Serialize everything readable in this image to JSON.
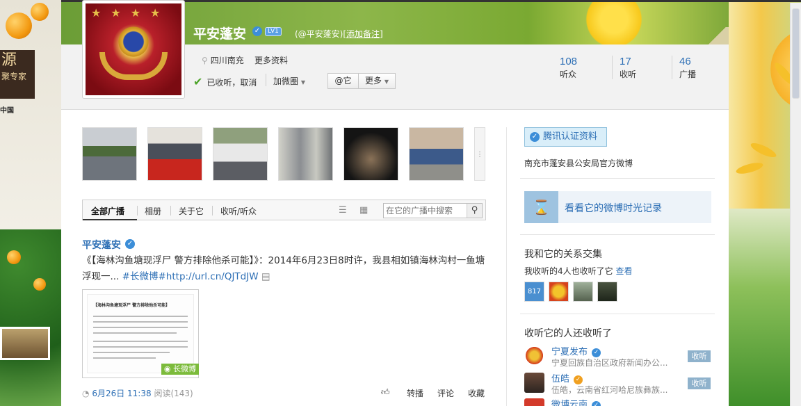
{
  "profile": {
    "name": "平安蓬安",
    "level_badge": "LV1",
    "handle": "(@平安蓬安)",
    "add_remark": "[添加备注]",
    "location": "四川南充",
    "more_info": "更多资料",
    "follow_status": "已收听，取消",
    "add_circle": "加微圈",
    "mention_button": "@它",
    "more_button": "更多"
  },
  "stats": {
    "listeners_count": "108",
    "listeners_label": "听众",
    "following_count": "17",
    "following_label": "收听",
    "broadcasts_count": "46",
    "broadcasts_label": "广播"
  },
  "tabs": {
    "all": "全部广播",
    "album": "相册",
    "about": "关于它",
    "follows": "收听/听众",
    "search_placeholder": "在它的广播中搜索"
  },
  "post": {
    "author": "平安蓬安",
    "text_part1": "《【海林沟鱼塘现浮尸 警方排除他杀可能】》：2014年6月23日8时许，我县相如镇海林沟村一鱼塘浮现一... ",
    "long_weibo_tag": "#长微博",
    "url": "#http://url.cn/QJTdJW",
    "image_title": "【海林沟鱼塘现浮尸 警方排除他杀可能】",
    "image_tag": "长微博",
    "time": "6月26日 11:38",
    "reads": "阅读(143)",
    "repost": "转播",
    "comment": "评论",
    "favorite": "收藏"
  },
  "sidebar": {
    "certify": "腾讯认证资料",
    "description": "南充市蓬安县公安局官方微博",
    "timeline": "看看它的微博时光记录",
    "relation_title": "我和它的关系交集",
    "mutual_text": "我收听的4人也收听了它",
    "mutual_look": "查看",
    "mutual_avatar_label": "817",
    "recommend_title": "收听它的人还收听了",
    "recommendations": [
      {
        "name": "宁夏发布",
        "desc": "宁夏回族自治区政府新闻办公...",
        "button": "收听"
      },
      {
        "name": "伍皓",
        "desc": "伍皓，云南省红河哈尼族彝族...",
        "button": "收听"
      },
      {
        "name": "微博云南",
        "desc": "",
        "button": ""
      }
    ]
  },
  "background": {
    "left_sign": "源",
    "left_sign_sub": "聚专家",
    "left_slogan": "中国"
  },
  "colors": {
    "link": "#2d6fb5",
    "verified": "#3c8ed8",
    "long_weibo": "#7cbb3b",
    "follow_btn": "#8fb2cc"
  }
}
